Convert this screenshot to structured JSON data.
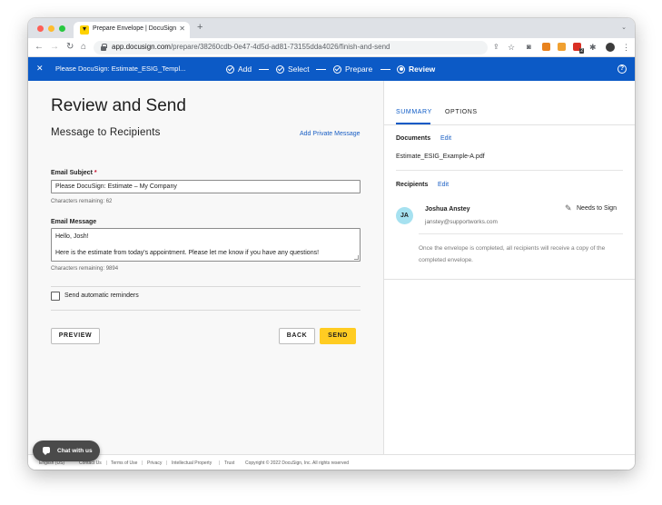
{
  "browser": {
    "tab_title": "Prepare Envelope | DocuSign",
    "url_host": "app.docusign.com",
    "url_path": "/prepare/38260cdb-0e47-4d5d-ad81-73155dda4026/finish-and-send",
    "extension_badge": "2"
  },
  "header": {
    "envelope_title": "Please DocuSign: Estimate_ESIG_Templ...",
    "steps": [
      {
        "label": "Add",
        "state": "done"
      },
      {
        "label": "Select",
        "state": "done"
      },
      {
        "label": "Prepare",
        "state": "done"
      },
      {
        "label": "Review",
        "state": "current"
      }
    ],
    "help_symbol": "?",
    "close_symbol": "✕"
  },
  "main": {
    "page_title": "Review and Send",
    "section_title": "Message to Recipients",
    "add_private_message": "Add Private Message",
    "subject_label": "Email Subject",
    "required_mark": "*",
    "subject_value": "Please DocuSign: Estimate – My Company",
    "subject_chars": "Characters remaining: 62",
    "message_label": "Email Message",
    "message_lines": [
      "Hello, Josh!",
      "",
      "Here is the estimate from today's appointment. Please let me know if you have any questions!"
    ],
    "message_chars": "Characters remaining: 9894",
    "reminders_label": "Send automatic reminders",
    "preview_button": "PREVIEW",
    "back_button": "BACK",
    "send_button": "SEND"
  },
  "summary": {
    "tabs": [
      {
        "label": "SUMMARY",
        "active": true
      },
      {
        "label": "OPTIONS",
        "active": false
      }
    ],
    "documents_heading": "Documents",
    "documents_edit": "Edit",
    "document_name": "Estimate_ESIG_Example-A.pdf",
    "recipients_heading": "Recipients",
    "recipients_edit": "Edit",
    "recipient": {
      "initials": "JA",
      "name": "Joshua Anstey",
      "email": "janstey@supportworks.com",
      "action": "Needs to Sign",
      "action_icon": "pen-icon"
    },
    "completion_note": "Once the envelope is completed, all recipients will receive a copy of the completed envelope."
  },
  "footer": {
    "links": [
      "English (US)",
      "Contact Us",
      "Terms of Use",
      "Privacy",
      "Intellectual Property",
      "Trust"
    ],
    "copyright": "Copyright © 2022 DocuSign, Inc. All rights reserved"
  },
  "chat": {
    "label": "Chat with us"
  },
  "colors": {
    "brand_blue": "#0c5ac6",
    "send_yellow": "#ffcc22",
    "avatar_cyan": "#a6e1f0",
    "link_blue": "#1a5fc4"
  }
}
